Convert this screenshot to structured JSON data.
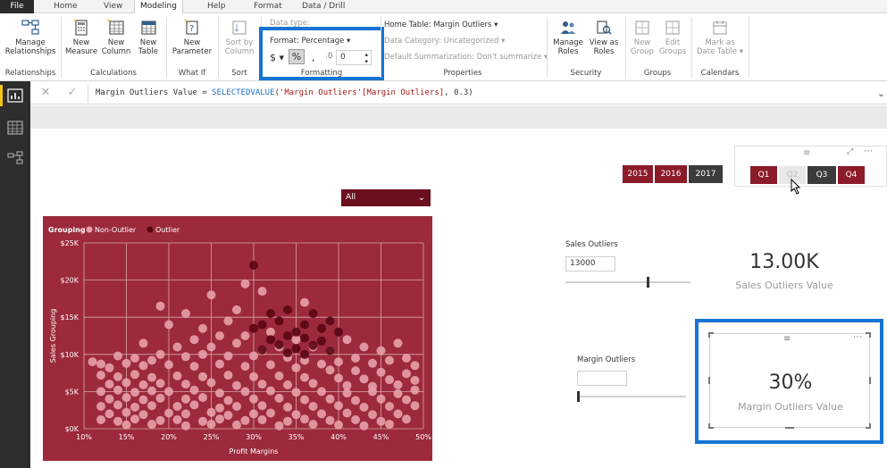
{
  "tabs": [
    {
      "label": "File"
    },
    {
      "label": "Home"
    },
    {
      "label": "View"
    },
    {
      "label": "Modeling"
    },
    {
      "label": "Help"
    },
    {
      "label": "Format"
    },
    {
      "label": "Data / Drill"
    }
  ],
  "ribbon": {
    "relationships": {
      "manage_label_1": "Manage",
      "manage_label_2": "Relationships",
      "group": "Relationships"
    },
    "calculations": {
      "new_measure_1": "New",
      "new_measure_2": "Measure",
      "new_column_1": "New",
      "new_column_2": "Column",
      "new_table_1": "New",
      "new_table_2": "Table",
      "group": "Calculations"
    },
    "whatif": {
      "new_param_1": "New",
      "new_param_2": "Parameter",
      "group": "What If"
    },
    "sort": {
      "sort_1": "Sort by",
      "sort_2": "Column",
      "group": "Sort"
    },
    "formatting": {
      "data_type": "Data type:",
      "format": "Format: Percentage",
      "currency": "$",
      "percent": "%",
      "comma": ",",
      "decimal_places": "0",
      "group": "Formatting"
    },
    "properties": {
      "home_table": "Home Table: Margin Outliers",
      "data_category": "Data Category: Uncategorized",
      "default_summarization": "Default Summarization: Don't summarize",
      "group": "Properties"
    },
    "security": {
      "manage_roles_1": "Manage",
      "manage_roles_2": "Roles",
      "view_as_1": "View as",
      "view_as_2": "Roles",
      "group": "Security"
    },
    "groups": {
      "new_group_1": "New",
      "new_group_2": "Group",
      "edit_groups_1": "Edit",
      "edit_groups_2": "Groups",
      "group": "Groups"
    },
    "calendars": {
      "mark_1": "Mark as",
      "mark_2": "Date Table",
      "group": "Calendars"
    }
  },
  "formula": {
    "prefix": "Margin Outliers Value = ",
    "fn": "SELECTEDVALUE",
    "args_open": "(",
    "arg_str": "'Margin Outliers'[Margin Outliers]",
    "args_rest": ", 0.3)"
  },
  "slicers": {
    "years": [
      "2015",
      "2016",
      "2017"
    ],
    "quarters": [
      "Q1",
      "Q2",
      "Q3",
      "Q4"
    ],
    "dropdown_value": "All"
  },
  "sales_outliers": {
    "label": "Sales Outliers",
    "value": "13000",
    "slider_fraction": 0.65
  },
  "sales_card": {
    "value": "13.00K",
    "label": "Sales Outliers Value"
  },
  "margin_outliers": {
    "label": "Margin Outliers",
    "value": "",
    "slider_fraction": 0.0
  },
  "margin_card": {
    "value": "30%",
    "label": "Margin Outliers Value"
  },
  "colors": {
    "accent_maroon": "#8c1b2a",
    "chart_bg": "#9c2a3c",
    "non_outlier": "#e8a0aa",
    "outlier": "#5a0614",
    "highlight_blue": "#1773d4"
  },
  "chart_data": {
    "type": "scatter",
    "legend_title": "Grouping",
    "legend": [
      "Non-Outlier",
      "Outlier"
    ],
    "legend_placement": "top-left",
    "xlabel": "Profit Margins",
    "ylabel": "Sales Grouping",
    "xlim": [
      0.1,
      0.5
    ],
    "ylim": [
      0,
      25000
    ],
    "x_ticks": [
      "10%",
      "15%",
      "20%",
      "25%",
      "30%",
      "35%",
      "40%",
      "45%",
      "50%"
    ],
    "y_ticks": [
      "$0K",
      "$5K",
      "$10K",
      "$15K",
      "$20K",
      "$25K"
    ],
    "grid": true,
    "series": [
      {
        "name": "Non-Outlier",
        "color": "#e8a0aa",
        "points": [
          [
            0.19,
            16500
          ],
          [
            0.29,
            19500
          ],
          [
            0.25,
            18000
          ],
          [
            0.31,
            18500
          ],
          [
            0.36,
            17000
          ],
          [
            0.22,
            15500
          ],
          [
            0.28,
            16000
          ],
          [
            0.2,
            14000
          ],
          [
            0.24,
            13500
          ],
          [
            0.27,
            14500
          ],
          [
            0.26,
            12500
          ],
          [
            0.23,
            12000
          ],
          [
            0.21,
            11000
          ],
          [
            0.17,
            11500
          ],
          [
            0.25,
            11000
          ],
          [
            0.29,
            12500
          ],
          [
            0.28,
            11500
          ],
          [
            0.32,
            13000
          ],
          [
            0.33,
            11000
          ],
          [
            0.35,
            12000
          ],
          [
            0.31,
            10500
          ],
          [
            0.37,
            11000
          ],
          [
            0.39,
            10500
          ],
          [
            0.41,
            12000
          ],
          [
            0.43,
            11000
          ],
          [
            0.45,
            10500
          ],
          [
            0.47,
            11500
          ],
          [
            0.42,
            9500
          ],
          [
            0.4,
            9000
          ],
          [
            0.44,
            8800
          ],
          [
            0.46,
            9200
          ],
          [
            0.48,
            9500
          ],
          [
            0.49,
            8500
          ],
          [
            0.38,
            8700
          ],
          [
            0.36,
            9200
          ],
          [
            0.34,
            9600
          ],
          [
            0.3,
            9800
          ],
          [
            0.27,
            9800
          ],
          [
            0.24,
            10000
          ],
          [
            0.22,
            9700
          ],
          [
            0.19,
            10000
          ],
          [
            0.18,
            9200
          ],
          [
            0.16,
            9500
          ],
          [
            0.14,
            9800
          ],
          [
            0.13,
            8200
          ],
          [
            0.15,
            8800
          ],
          [
            0.17,
            8500
          ],
          [
            0.2,
            8600
          ],
          [
            0.23,
            8400
          ],
          [
            0.26,
            8700
          ],
          [
            0.29,
            8400
          ],
          [
            0.32,
            8600
          ],
          [
            0.35,
            8200
          ],
          [
            0.39,
            7900
          ],
          [
            0.42,
            7800
          ],
          [
            0.45,
            7600
          ],
          [
            0.48,
            7400
          ],
          [
            0.12,
            7200
          ],
          [
            0.14,
            7000
          ],
          [
            0.16,
            7300
          ],
          [
            0.18,
            6900
          ],
          [
            0.21,
            7100
          ],
          [
            0.24,
            7000
          ],
          [
            0.27,
            7200
          ],
          [
            0.3,
            7000
          ],
          [
            0.33,
            7100
          ],
          [
            0.36,
            6900
          ],
          [
            0.4,
            6800
          ],
          [
            0.43,
            6700
          ],
          [
            0.46,
            6600
          ],
          [
            0.49,
            6500
          ],
          [
            0.13,
            6000
          ],
          [
            0.15,
            6200
          ],
          [
            0.17,
            5900
          ],
          [
            0.19,
            6100
          ],
          [
            0.22,
            6000
          ],
          [
            0.25,
            6200
          ],
          [
            0.28,
            5800
          ],
          [
            0.31,
            6000
          ],
          [
            0.34,
            5900
          ],
          [
            0.37,
            6100
          ],
          [
            0.41,
            5800
          ],
          [
            0.44,
            5700
          ],
          [
            0.47,
            5900
          ],
          [
            0.12,
            5000
          ],
          [
            0.14,
            5200
          ],
          [
            0.16,
            4900
          ],
          [
            0.18,
            5100
          ],
          [
            0.2,
            5000
          ],
          [
            0.23,
            5200
          ],
          [
            0.26,
            4800
          ],
          [
            0.29,
            5000
          ],
          [
            0.32,
            5100
          ],
          [
            0.35,
            4900
          ],
          [
            0.38,
            5000
          ],
          [
            0.41,
            4800
          ],
          [
            0.44,
            5000
          ],
          [
            0.47,
            4700
          ],
          [
            0.49,
            5200
          ],
          [
            0.13,
            4000
          ],
          [
            0.15,
            4200
          ],
          [
            0.17,
            3900
          ],
          [
            0.19,
            4100
          ],
          [
            0.22,
            4000
          ],
          [
            0.24,
            4200
          ],
          [
            0.27,
            3800
          ],
          [
            0.3,
            4000
          ],
          [
            0.33,
            4100
          ],
          [
            0.36,
            3900
          ],
          [
            0.39,
            4000
          ],
          [
            0.42,
            3800
          ],
          [
            0.45,
            4000
          ],
          [
            0.48,
            3900
          ],
          [
            0.12,
            3000
          ],
          [
            0.14,
            3200
          ],
          [
            0.16,
            2900
          ],
          [
            0.18,
            3100
          ],
          [
            0.21,
            3000
          ],
          [
            0.23,
            3200
          ],
          [
            0.26,
            2800
          ],
          [
            0.28,
            3000
          ],
          [
            0.31,
            3100
          ],
          [
            0.34,
            2900
          ],
          [
            0.37,
            3000
          ],
          [
            0.4,
            3100
          ],
          [
            0.43,
            2900
          ],
          [
            0.46,
            3000
          ],
          [
            0.49,
            3100
          ],
          [
            0.13,
            2000
          ],
          [
            0.15,
            2200
          ],
          [
            0.17,
            1900
          ],
          [
            0.2,
            2100
          ],
          [
            0.22,
            2000
          ],
          [
            0.25,
            2200
          ],
          [
            0.27,
            1800
          ],
          [
            0.3,
            2000
          ],
          [
            0.32,
            2100
          ],
          [
            0.35,
            1900
          ],
          [
            0.38,
            2000
          ],
          [
            0.41,
            2100
          ],
          [
            0.44,
            1900
          ],
          [
            0.47,
            2000
          ],
          [
            0.12,
            1200
          ],
          [
            0.14,
            1000
          ],
          [
            0.16,
            1300
          ],
          [
            0.19,
            1100
          ],
          [
            0.21,
            1200
          ],
          [
            0.24,
            1000
          ],
          [
            0.26,
            1300
          ],
          [
            0.29,
            1100
          ],
          [
            0.31,
            1200
          ],
          [
            0.34,
            1000
          ],
          [
            0.36,
            1300
          ],
          [
            0.39,
            1100
          ],
          [
            0.42,
            1200
          ],
          [
            0.45,
            1000
          ],
          [
            0.48,
            1300
          ],
          [
            0.15,
            500
          ],
          [
            0.18,
            600
          ],
          [
            0.22,
            400
          ],
          [
            0.25,
            600
          ],
          [
            0.28,
            500
          ],
          [
            0.33,
            400
          ],
          [
            0.37,
            600
          ],
          [
            0.4,
            500
          ],
          [
            0.43,
            400
          ],
          [
            0.46,
            600
          ],
          [
            0.11,
            9000
          ],
          [
            0.12,
            8700
          ]
        ]
      },
      {
        "name": "Outlier",
        "color": "#5a0614",
        "points": [
          [
            0.3,
            22000
          ],
          [
            0.32,
            15500
          ],
          [
            0.34,
            16000
          ],
          [
            0.37,
            15500
          ],
          [
            0.39,
            14500
          ],
          [
            0.3,
            13500
          ],
          [
            0.31,
            14000
          ],
          [
            0.33,
            14500
          ],
          [
            0.35,
            13000
          ],
          [
            0.36,
            14000
          ],
          [
            0.38,
            13500
          ],
          [
            0.4,
            13000
          ],
          [
            0.32,
            12000
          ],
          [
            0.34,
            12500
          ],
          [
            0.36,
            12200
          ],
          [
            0.38,
            11800
          ],
          [
            0.33,
            11300
          ],
          [
            0.35,
            10800
          ],
          [
            0.37,
            11200
          ],
          [
            0.39,
            10500
          ],
          [
            0.31,
            10600
          ],
          [
            0.34,
            10200
          ],
          [
            0.36,
            10000
          ]
        ]
      }
    ]
  }
}
